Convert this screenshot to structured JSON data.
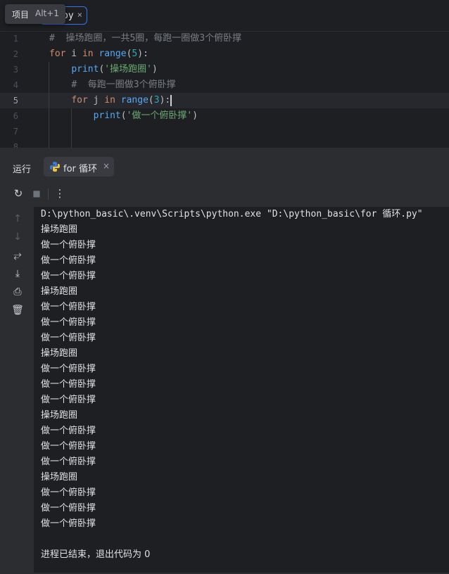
{
  "tooltip": {
    "title": "项目",
    "shortcut": "Alt+1"
  },
  "editor_tab": {
    "name": "py",
    "close": "×"
  },
  "editor": {
    "line_numbers": [
      "1",
      "2",
      "3",
      "4",
      "5",
      "6",
      "7",
      "8"
    ],
    "active_line": 5,
    "lines": [
      [
        {
          "t": "#  操场跑圈，一共5圈，每跑一圈做3个俯卧撑",
          "c": "cmt"
        }
      ],
      [
        {
          "t": "for",
          "c": "kw"
        },
        {
          "t": " i ",
          "c": "plain"
        },
        {
          "t": "in",
          "c": "kw"
        },
        {
          "t": " ",
          "c": "plain"
        },
        {
          "t": "range",
          "c": "fn"
        },
        {
          "t": "(",
          "c": "plain"
        },
        {
          "t": "5",
          "c": "num"
        },
        {
          "t": "):",
          "c": "plain"
        }
      ],
      [
        {
          "t": "    ",
          "c": "plain"
        },
        {
          "t": "print",
          "c": "fn"
        },
        {
          "t": "(",
          "c": "plain"
        },
        {
          "t": "'操场跑圈'",
          "c": "str"
        },
        {
          "t": ")",
          "c": "plain"
        }
      ],
      [
        {
          "t": "    ",
          "c": "plain"
        },
        {
          "t": "#  每跑一圈做3个俯卧撑",
          "c": "cmt"
        }
      ],
      [
        {
          "t": "    ",
          "c": "plain"
        },
        {
          "t": "for",
          "c": "kw"
        },
        {
          "t": " j ",
          "c": "plain"
        },
        {
          "t": "in",
          "c": "kw"
        },
        {
          "t": " ",
          "c": "plain"
        },
        {
          "t": "range",
          "c": "fn"
        },
        {
          "t": "(",
          "c": "plain"
        },
        {
          "t": "3",
          "c": "num"
        },
        {
          "t": "):",
          "c": "plain"
        }
      ],
      [
        {
          "t": "        ",
          "c": "plain"
        },
        {
          "t": "print",
          "c": "fn"
        },
        {
          "t": "(",
          "c": "plain"
        },
        {
          "t": "'做一个俯卧撑'",
          "c": "str"
        },
        {
          "t": ")",
          "c": "plain"
        }
      ],
      [],
      []
    ]
  },
  "run_panel": {
    "title": "运行",
    "tab_label": "for 循环",
    "tab_close": "×",
    "toolbar": {
      "rerun": "↻",
      "stop": "■",
      "more": "⋮"
    },
    "console_lines": [
      "D:\\python_basic\\.venv\\Scripts\\python.exe \"D:\\python_basic\\for 循环.py\"",
      "操场跑圈",
      "做一个俯卧撑",
      "做一个俯卧撑",
      "做一个俯卧撑",
      "操场跑圈",
      "做一个俯卧撑",
      "做一个俯卧撑",
      "做一个俯卧撑",
      "操场跑圈",
      "做一个俯卧撑",
      "做一个俯卧撑",
      "做一个俯卧撑",
      "操场跑圈",
      "做一个俯卧撑",
      "做一个俯卧撑",
      "做一个俯卧撑",
      "操场跑圈",
      "做一个俯卧撑",
      "做一个俯卧撑",
      "做一个俯卧撑",
      "",
      "进程已结束，退出代码为 0"
    ]
  },
  "side_tools": [
    {
      "name": "scroll-up-icon",
      "glyph": "↑",
      "dim": true
    },
    {
      "name": "scroll-down-icon",
      "glyph": "↓",
      "dim": true
    },
    {
      "name": "soft-wrap-icon",
      "glyph": "⥂",
      "dim": false
    },
    {
      "name": "scroll-to-end-icon",
      "glyph": "⤓",
      "dim": false
    },
    {
      "name": "print-icon",
      "glyph": "⎙",
      "dim": false
    },
    {
      "name": "trash-icon",
      "glyph": "🗑",
      "dim": false
    }
  ]
}
